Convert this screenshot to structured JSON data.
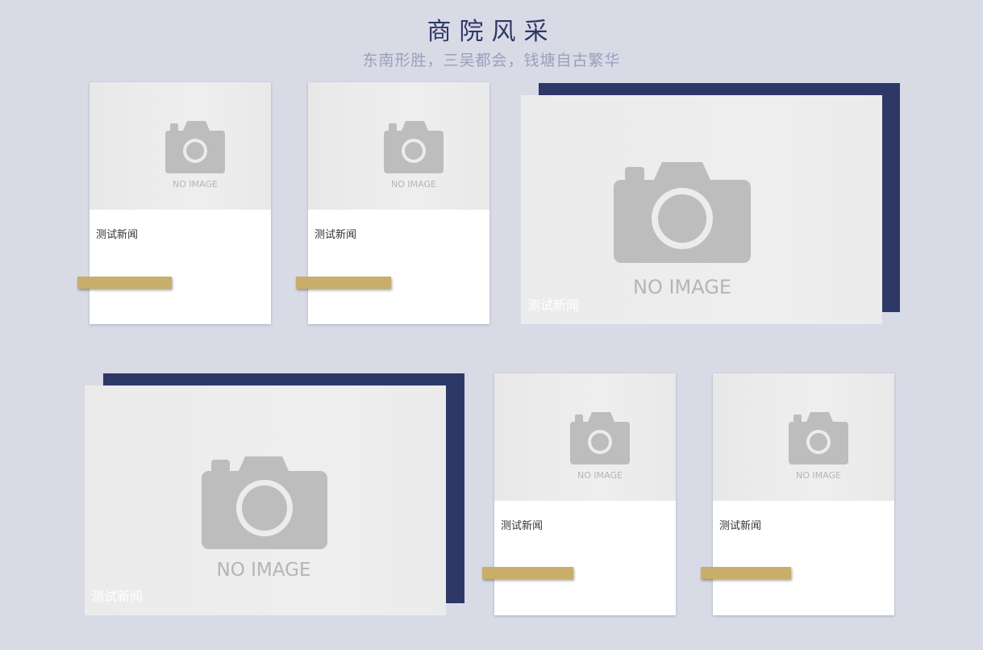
{
  "header": {
    "title": "商院风采",
    "subtitle": "东南形胜，三吴都会，钱塘自古繁华"
  },
  "placeholder": {
    "text": "NO IMAGE",
    "icon": "camera-icon"
  },
  "cards": [
    {
      "caption": "测试新闻"
    },
    {
      "caption": "测试新闻"
    },
    {
      "caption": "测试新闻"
    },
    {
      "caption": "测试新闻"
    },
    {
      "caption": "测试新闻"
    },
    {
      "caption": "测试新闻"
    }
  ],
  "colors": {
    "background": "#d8dae6",
    "navy": "#2d3867",
    "gold": "#c8ae6a",
    "title": "#2e3866",
    "subtitle": "#9aa0bb"
  }
}
